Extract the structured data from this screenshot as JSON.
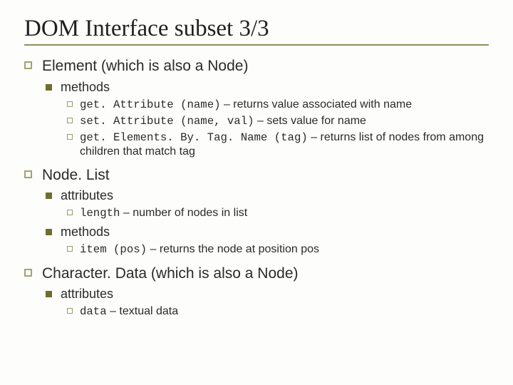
{
  "title": "DOM Interface subset 3/3",
  "sections": [
    {
      "heading": "Element (which is also a Node)",
      "subs": [
        {
          "label": "methods",
          "items": [
            {
              "code": "get. Attribute (name)",
              "desc": " – returns value associated with name"
            },
            {
              "code": "set. Attribute (name, val)",
              "desc": " – sets value for name"
            },
            {
              "code": "get. Elements. By. Tag. Name (tag)",
              "desc": " – returns list of nodes from among children that match tag"
            }
          ]
        }
      ]
    },
    {
      "heading": "Node. List",
      "subs": [
        {
          "label": "attributes",
          "items": [
            {
              "code": "length",
              "desc": " – number of nodes in list"
            }
          ]
        },
        {
          "label": "methods",
          "items": [
            {
              "code": "item (pos)",
              "desc": " – returns the node at position pos"
            }
          ]
        }
      ]
    },
    {
      "heading": "Character. Data (which is also a Node)",
      "subs": [
        {
          "label": "attributes",
          "items": [
            {
              "code": "data",
              "desc": " – textual data"
            }
          ]
        }
      ]
    }
  ]
}
